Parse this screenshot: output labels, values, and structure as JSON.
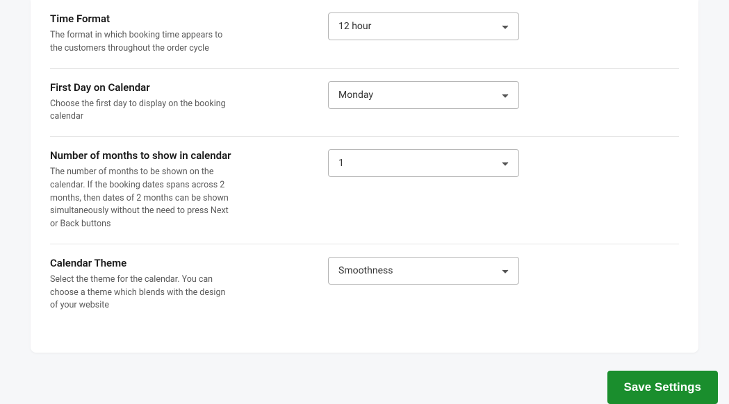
{
  "settings": [
    {
      "title": "Time Format",
      "desc": "The format in which booking time appears to the customers throughout the order cycle",
      "value": "12 hour",
      "name": "time-format"
    },
    {
      "title": "First Day on Calendar",
      "desc": "Choose the first day to display on the booking calendar",
      "value": "Monday",
      "name": "first-day-calendar"
    },
    {
      "title": "Number of months to show in calendar",
      "desc": "The number of months to be shown on the calendar. If the booking dates spans across 2 months, then dates of 2 months can be shown simultaneously without the need to press Next or Back buttons",
      "value": "1",
      "name": "number-months"
    },
    {
      "title": "Calendar Theme",
      "desc": "Select the theme for the calendar. You can choose a theme which blends with the design of your website",
      "value": "Smoothness",
      "name": "calendar-theme"
    }
  ],
  "footer": {
    "save_label": "Save Settings"
  }
}
